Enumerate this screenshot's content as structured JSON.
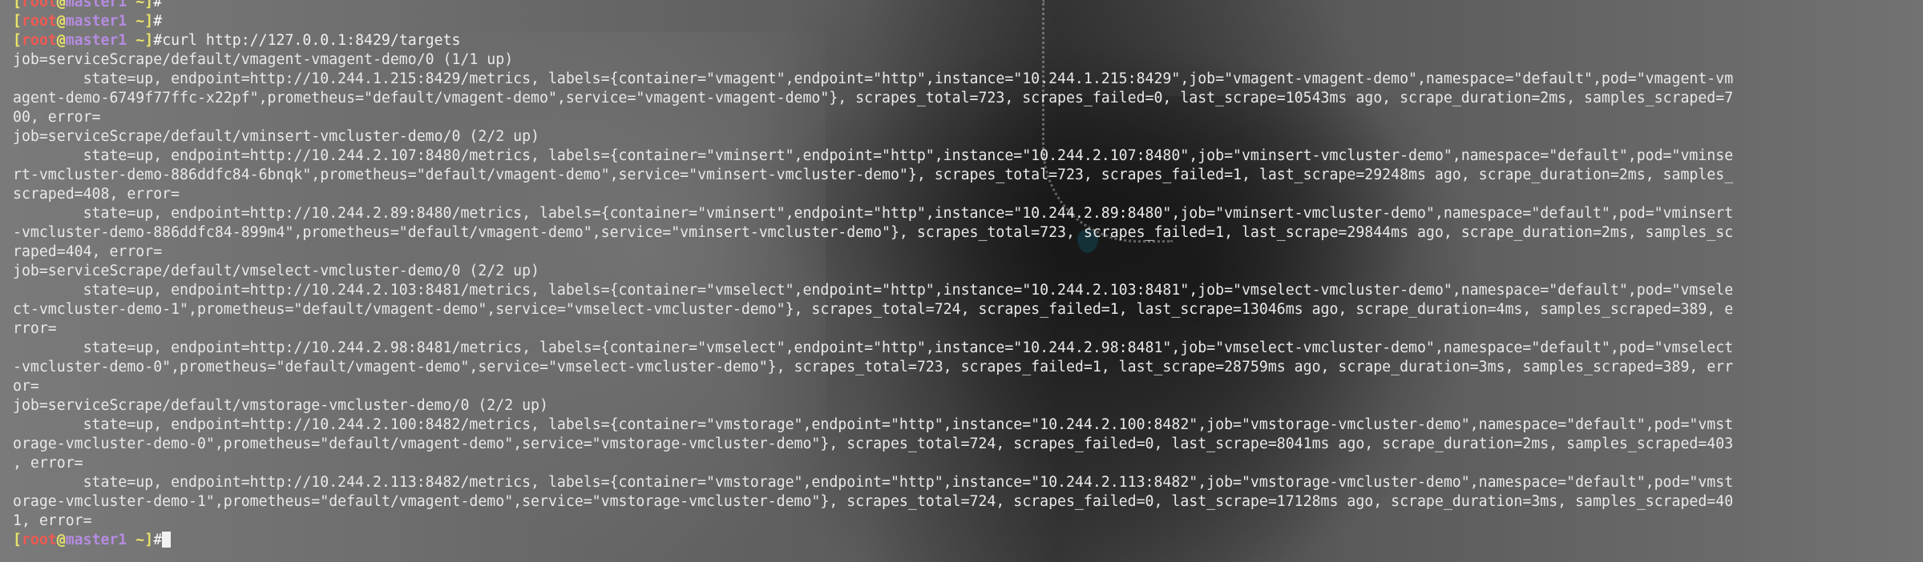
{
  "terminal": {
    "prompt": {
      "user": "root",
      "host": "master1",
      "path": "~",
      "symbol": "#"
    },
    "lines": [
      {
        "type": "prompt",
        "command": ""
      },
      {
        "type": "prompt",
        "command": ""
      },
      {
        "type": "prompt",
        "command": "curl http://127.0.0.1:8429/targets"
      },
      {
        "type": "output",
        "text": "job=serviceScrape/default/vmagent-vmagent-demo/0 (1/1 up)"
      },
      {
        "type": "output",
        "text": "        state=up, endpoint=http://10.244.1.215:8429/metrics, labels={container=\"vmagent\",endpoint=\"http\",instance=\"10.244.1.215:8429\",job=\"vmagent-vmagent-demo\",namespace=\"default\",pod=\"vmagent-vm"
      },
      {
        "type": "output",
        "text": "agent-demo-6749f77ffc-x22pf\",prometheus=\"default/vmagent-demo\",service=\"vmagent-vmagent-demo\"}, scrapes_total=723, scrapes_failed=0, last_scrape=10543ms ago, scrape_duration=2ms, samples_scraped=7"
      },
      {
        "type": "output",
        "text": "00, error="
      },
      {
        "type": "output",
        "text": "job=serviceScrape/default/vminsert-vmcluster-demo/0 (2/2 up)"
      },
      {
        "type": "output",
        "text": "        state=up, endpoint=http://10.244.2.107:8480/metrics, labels={container=\"vminsert\",endpoint=\"http\",instance=\"10.244.2.107:8480\",job=\"vminsert-vmcluster-demo\",namespace=\"default\",pod=\"vminse"
      },
      {
        "type": "output",
        "text": "rt-vmcluster-demo-886ddfc84-6bnqk\",prometheus=\"default/vmagent-demo\",service=\"vminsert-vmcluster-demo\"}, scrapes_total=723, scrapes_failed=1, last_scrape=29248ms ago, scrape_duration=2ms, samples_"
      },
      {
        "type": "output",
        "text": "scraped=408, error="
      },
      {
        "type": "output",
        "text": "        state=up, endpoint=http://10.244.2.89:8480/metrics, labels={container=\"vminsert\",endpoint=\"http\",instance=\"10.244.2.89:8480\",job=\"vminsert-vmcluster-demo\",namespace=\"default\",pod=\"vminsert"
      },
      {
        "type": "output",
        "text": "-vmcluster-demo-886ddfc84-899m4\",prometheus=\"default/vmagent-demo\",service=\"vminsert-vmcluster-demo\"}, scrapes_total=723, scrapes_failed=1, last_scrape=29844ms ago, scrape_duration=2ms, samples_sc"
      },
      {
        "type": "output",
        "text": "raped=404, error="
      },
      {
        "type": "output",
        "text": "job=serviceScrape/default/vmselect-vmcluster-demo/0 (2/2 up)"
      },
      {
        "type": "output",
        "text": "        state=up, endpoint=http://10.244.2.103:8481/metrics, labels={container=\"vmselect\",endpoint=\"http\",instance=\"10.244.2.103:8481\",job=\"vmselect-vmcluster-demo\",namespace=\"default\",pod=\"vmsele"
      },
      {
        "type": "output",
        "text": "ct-vmcluster-demo-1\",prometheus=\"default/vmagent-demo\",service=\"vmselect-vmcluster-demo\"}, scrapes_total=724, scrapes_failed=1, last_scrape=13046ms ago, scrape_duration=4ms, samples_scraped=389, e"
      },
      {
        "type": "output",
        "text": "rror="
      },
      {
        "type": "output",
        "text": "        state=up, endpoint=http://10.244.2.98:8481/metrics, labels={container=\"vmselect\",endpoint=\"http\",instance=\"10.244.2.98:8481\",job=\"vmselect-vmcluster-demo\",namespace=\"default\",pod=\"vmselect"
      },
      {
        "type": "output",
        "text": "-vmcluster-demo-0\",prometheus=\"default/vmagent-demo\",service=\"vmselect-vmcluster-demo\"}, scrapes_total=723, scrapes_failed=1, last_scrape=28759ms ago, scrape_duration=3ms, samples_scraped=389, err"
      },
      {
        "type": "output",
        "text": "or="
      },
      {
        "type": "output",
        "text": "job=serviceScrape/default/vmstorage-vmcluster-demo/0 (2/2 up)"
      },
      {
        "type": "output",
        "text": "        state=up, endpoint=http://10.244.2.100:8482/metrics, labels={container=\"vmstorage\",endpoint=\"http\",instance=\"10.244.2.100:8482\",job=\"vmstorage-vmcluster-demo\",namespace=\"default\",pod=\"vmst"
      },
      {
        "type": "output",
        "text": "orage-vmcluster-demo-0\",prometheus=\"default/vmagent-demo\",service=\"vmstorage-vmcluster-demo\"}, scrapes_total=724, scrapes_failed=0, last_scrape=8041ms ago, scrape_duration=2ms, samples_scraped=403"
      },
      {
        "type": "output",
        "text": ", error="
      },
      {
        "type": "output",
        "text": "        state=up, endpoint=http://10.244.2.113:8482/metrics, labels={container=\"vmstorage\",endpoint=\"http\",instance=\"10.244.2.113:8482\",job=\"vmstorage-vmcluster-demo\",namespace=\"default\",pod=\"vmst"
      },
      {
        "type": "output",
        "text": "orage-vmcluster-demo-1\",prometheus=\"default/vmagent-demo\",service=\"vmstorage-vmcluster-demo\"}, scrapes_total=724, scrapes_failed=0, last_scrape=17128ms ago, scrape_duration=3ms, samples_scraped=40"
      },
      {
        "type": "output",
        "text": "1, error="
      },
      {
        "type": "prompt",
        "command": "",
        "cursor": true
      }
    ],
    "colors": {
      "bracket": "#e8e36a",
      "user": "#ef5a52",
      "host": "#b58be0",
      "text": "#e9e9e9"
    }
  }
}
